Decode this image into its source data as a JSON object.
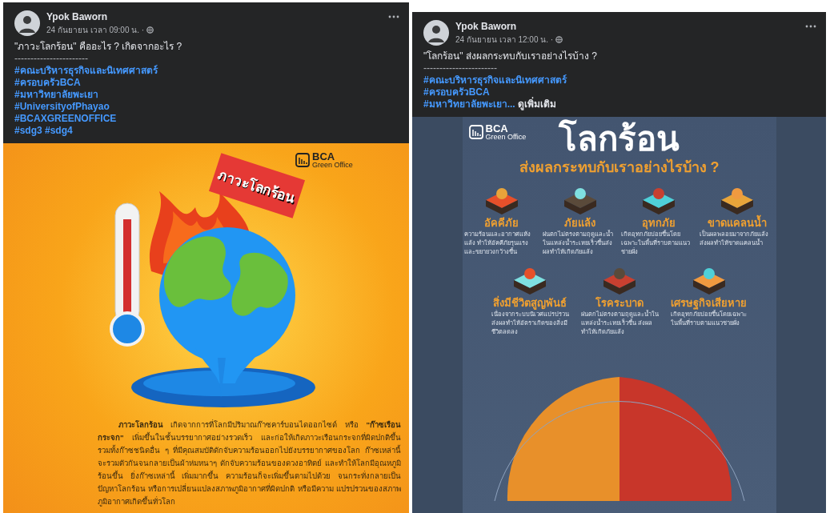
{
  "posts": [
    {
      "author": "Ypok Baworn",
      "time": "24 กันยายน เวลา 09:00 น. ·",
      "caption": "\"ภาวะโลกร้อน\" คืออะไร ? เกิดจากอะไร ?",
      "separator": "-----------------------",
      "hashtags": [
        "#คณะบริหารธุรกิจและนิเทศศาสตร์",
        "#ครอบครัวBCA",
        "#มหาวิทยาลัยพะเยา",
        "#UniversityofPhayao",
        "#BCAXGREENOFFICE",
        "#sdg3 #sdg4"
      ],
      "poster": {
        "kind": "explainer",
        "logo": {
          "name": "BCA",
          "subtitle": "Green Office"
        },
        "sign": "ภาวะโลกร้อน",
        "body": "**ภาวะโลกร้อน** เกิดจากการที่โลกมีปริมาณก๊าซคาร์บอนไดออกไซด์ หรือ **\"ก๊าซเรือนกระจก\"** เพิ่มขึ้นในชั้นบรรยากาศอย่างรวดเร็ว และก่อให้เกิดภาวะเรือนกระจกที่ผิดปกติขึ้น รวมทั้งก๊าซชนิดอื่น ๆ ที่มีคุณสมบัติดักจับความร้อนออกไปยังบรรยากาศของโลก ก๊าซเหล่านี้จะรวมตัวกันจนกลายเป็นผ้าห่มหนาๆ ดักจับความร้อนของดวงอาทิตย์ และทำให้โลกมีอุณหภูมิร้อนขึ้น ยิ่งก๊าซเหล่านี้ เพิ่มมากขึ้น ความร้อนก็จะเพิ่มขึ้นตามไปด้วย จนกระทั่งกลายเป็นปัญหาโลกร้อน หรือการเปลี่ยนแปลงสภาพภูมิอากาศที่ผิดปกติ หรือมีความ แปรปรวนของสภาพภูมิอากาศเกิดขึ้นทั่วโลก"
      }
    },
    {
      "author": "Ypok Baworn",
      "time": "24 กันยายน เวลา 12:00 น. ·",
      "caption": "\"โลกร้อน\" ส่งผลกระทบกับเราอย่างไรบ้าง ?",
      "separator": "-----------------------",
      "hashtags": [
        "#คณะบริหารธุรกิจและนิเทศศาสตร์",
        "#ครอบครัวBCA",
        "#มหาวิทยาลัยพะเยา..."
      ],
      "see_more": "ดูเพิ่มเติม",
      "poster": {
        "kind": "impacts",
        "logo": {
          "name": "BCA",
          "subtitle": "Green Office"
        },
        "title": "โลกร้อน",
        "subtitle": "ส่งผลกระทบกับเราอย่างไรบ้าง ?",
        "impacts": [
          {
            "title": "อัคคีภัย",
            "text": "ความร้อนและอากาศแห้งแล้ง ทำให้อัคคีภัยรุนแรงและขยายวงกว้างขึ้น"
          },
          {
            "title": "ภัยแล้ง",
            "text": "ฝนตกไม่ตรงตามฤดูและน้ำในแหล่งน้ำระเหยเร็วขึ้นส่งผลทำให้เกิดภัยแล้ง"
          },
          {
            "title": "อุทกภัย",
            "text": "เกิดอุทกภัยบ่อยขึ้นโดยเฉพาะในพื้นที่ราบตามแนวชายฝั่ง"
          },
          {
            "title": "ขาดแคลนน้ำ",
            "text": "เป็นผลพลอยมาจากภัยแล้ง ส่งผลทำให้ขาดแคลนน้ำ"
          },
          {
            "title": "สิ่งมีชีวิตสูญพันธ์",
            "text": "เนื่องจากระบบนิเวศแปรปรวน ส่งผลทำให้อัตราเกิดของสิ่งมีชีวิตลดลง"
          },
          {
            "title": "โรคระบาด",
            "text": "ฝนตกไม่ตรงตามฤดูและน้ำในแหล่งน้ำระเหยเร็วขึ้น ส่งผลทำให้เกิดภัยแล้ง"
          },
          {
            "title": "เศรษฐกิจเสียหาย",
            "text": "เกิดอุทกภัยบ่อยขึ้นโดยเฉพาะในพื้นที่ราบตามแนวชายฝั่ง"
          }
        ]
      }
    }
  ]
}
